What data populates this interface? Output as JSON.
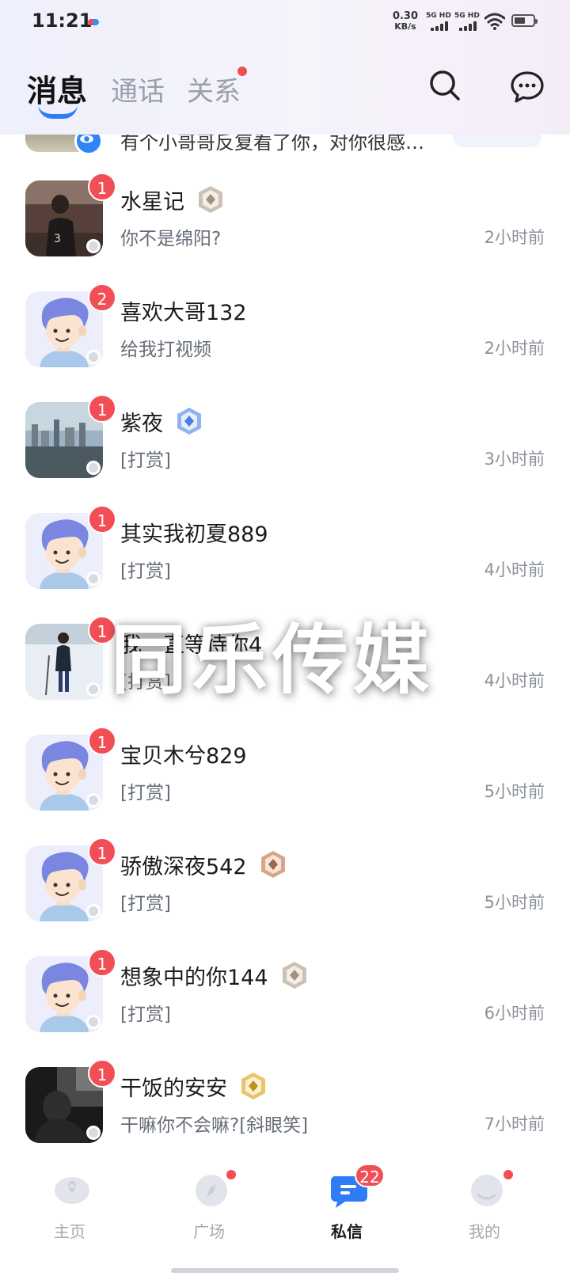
{
  "status_bar": {
    "time": "11:21",
    "net_speed_value": "0.30",
    "net_speed_unit": "KB/s",
    "sim1_label": "5G HD",
    "sim2_label": "5G HD",
    "battery_level": 0.6
  },
  "header": {
    "tabs": [
      {
        "label": "消息",
        "active": true
      },
      {
        "label": "通话",
        "active": false
      },
      {
        "label": "关系",
        "active": false,
        "has_dot": true
      }
    ],
    "search_icon": "search-icon",
    "chat_icon": "chat-bubble-icon"
  },
  "partial_row": {
    "text": "有个小哥哥反复看了你，对你很感…"
  },
  "conversations": [
    {
      "name": "水星记",
      "unread": "1",
      "message": "你不是绵阳?",
      "time": "2小时前",
      "avatar": "photo-stadium",
      "level": "silver"
    },
    {
      "name": "喜欢大哥132",
      "unread": "2",
      "message": "给我打视频",
      "time": "2小时前",
      "avatar": "cartoon-boy",
      "level": ""
    },
    {
      "name": "紫夜",
      "unread": "1",
      "message": "[打赏]",
      "time": "3小时前",
      "avatar": "photo-city",
      "level": "diamond"
    },
    {
      "name": "其实我初夏889",
      "unread": "1",
      "message": "[打赏]",
      "time": "4小时前",
      "avatar": "cartoon-boy",
      "level": ""
    },
    {
      "name": "我一直等待你4",
      "unread": "1",
      "message": "[打赏]",
      "time": "4小时前",
      "avatar": "photo-snow",
      "level": ""
    },
    {
      "name": "宝贝木兮829",
      "unread": "1",
      "message": "[打赏]",
      "time": "5小时前",
      "avatar": "cartoon-boy",
      "level": ""
    },
    {
      "name": "骄傲深夜542",
      "unread": "1",
      "message": "[打赏]",
      "time": "5小时前",
      "avatar": "cartoon-boy",
      "level": "bronze"
    },
    {
      "name": "想象中的你144",
      "unread": "1",
      "message": "[打赏]",
      "time": "6小时前",
      "avatar": "cartoon-boy",
      "level": "silver"
    },
    {
      "name": "干饭的安安",
      "unread": "1",
      "message": "干嘛你不会嘛?[斜眼笑]",
      "time": "7小时前",
      "avatar": "photo-dark",
      "level": "gold"
    }
  ],
  "watermark": "同乐传媒",
  "bottom_nav": [
    {
      "label": "主页",
      "icon": "home-icon",
      "active": false,
      "dot": false
    },
    {
      "label": "广场",
      "icon": "compass-icon",
      "active": false,
      "dot": true
    },
    {
      "label": "私信",
      "icon": "message-icon",
      "active": true,
      "count": "22"
    },
    {
      "label": "我的",
      "icon": "profile-icon",
      "active": false,
      "dot": true
    }
  ],
  "colors": {
    "accent": "#2e7cf6",
    "badge_red": "#f24e55",
    "cartoon_hair": "#7a86e0"
  }
}
